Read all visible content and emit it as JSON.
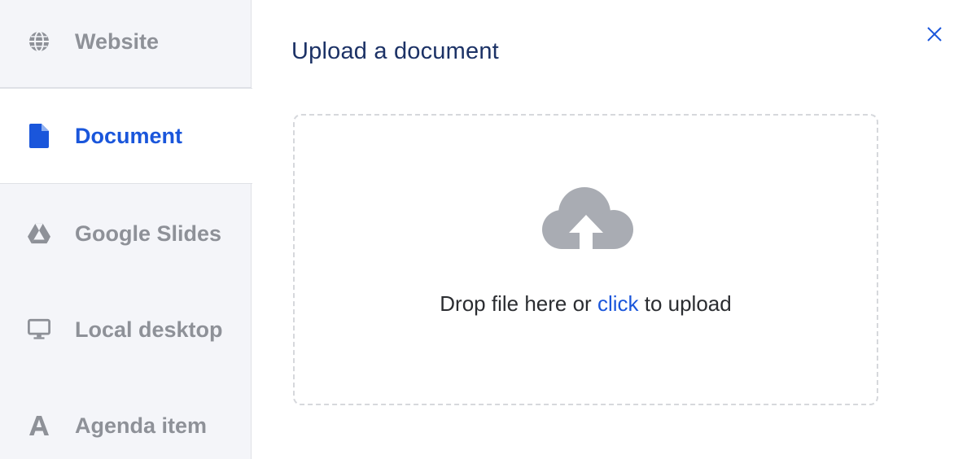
{
  "sidebar": {
    "items": [
      {
        "label": "Website",
        "icon": "globe-icon",
        "active": false
      },
      {
        "label": "Document",
        "icon": "document-icon",
        "active": true
      },
      {
        "label": "Google Slides",
        "icon": "google-drive-icon",
        "active": false
      },
      {
        "label": "Local desktop",
        "icon": "monitor-icon",
        "active": false
      },
      {
        "label": "Agenda item",
        "icon": "letter-a-icon",
        "active": false
      }
    ]
  },
  "main": {
    "title": "Upload a document",
    "close_icon": "close-icon",
    "dropzone": {
      "icon": "cloud-upload-icon",
      "text_before": "Drop file here or ",
      "link_text": "click",
      "text_after": " to upload"
    }
  },
  "colors": {
    "accent": "#1a56db",
    "title": "#1c3266",
    "inactive_text": "#8e9198",
    "sidebar_bg": "#f4f5f9",
    "icon_gray": "#a9acb3"
  }
}
